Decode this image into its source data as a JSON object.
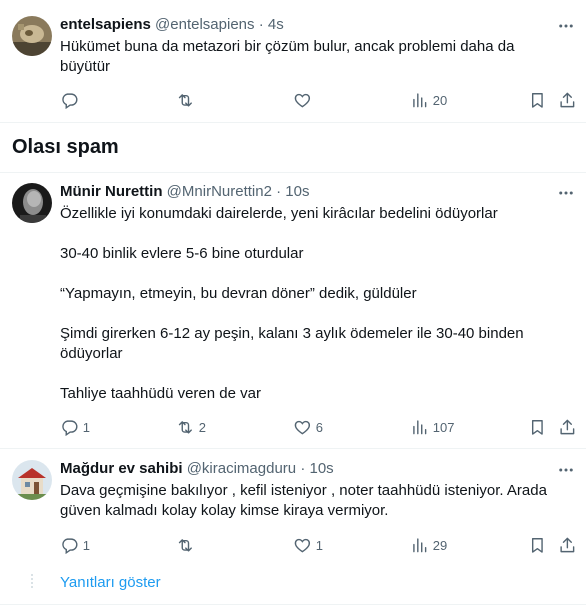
{
  "tweet1": {
    "name": "entelsapiens",
    "handle": "@entelsapiens",
    "sep": "·",
    "time": "4s",
    "text_lines": [
      "Hükümet buna da metazori bir çözüm bulur, ancak problemi daha da",
      "büyütür"
    ],
    "views": "20"
  },
  "spam_section": {
    "title": "Olası spam"
  },
  "tweet2": {
    "name": "Münir Nurettin",
    "handle": "@MnirNurettin2",
    "sep": "·",
    "time": "10s",
    "paragraphs": [
      "Özellikle iyi konumdaki dairelerde, yeni kirâcılar bedelini ödüyorlar",
      "30-40 binlik evlere 5-6 bine oturdular",
      "“Yapmayın, etmeyin, bu devran döner” dedik, güldüler",
      "Şimdi girerken 6-12 ay peşin, kalanı 3 aylık ödemeler ile 30-40 binden ödüyorlar",
      "Tahliye taahhüdü veren de var"
    ],
    "replies": "1",
    "retweets": "2",
    "likes": "6",
    "views": "107"
  },
  "tweet3": {
    "name": "Mağdur ev sahibi",
    "handle": "@kiracimagduru",
    "sep": "·",
    "time": "10s",
    "text": "Dava geçmişine bakılıyor , kefil isteniyor , noter taahhüdü isteniyor. Arada güven kalmadı kolay kolay kimse kiraya vermiyor.",
    "replies": "1",
    "likes": "1",
    "views": "29"
  },
  "show_replies": "Yanıtları göster",
  "colors": {
    "text": "#0f1419",
    "secondary": "#536471",
    "accent": "#1d9bf0",
    "divider": "#eff3f4"
  },
  "icons": [
    "reply-icon",
    "retweet-icon",
    "like-icon",
    "views-icon",
    "bookmark-icon",
    "share-icon",
    "more-icon"
  ]
}
